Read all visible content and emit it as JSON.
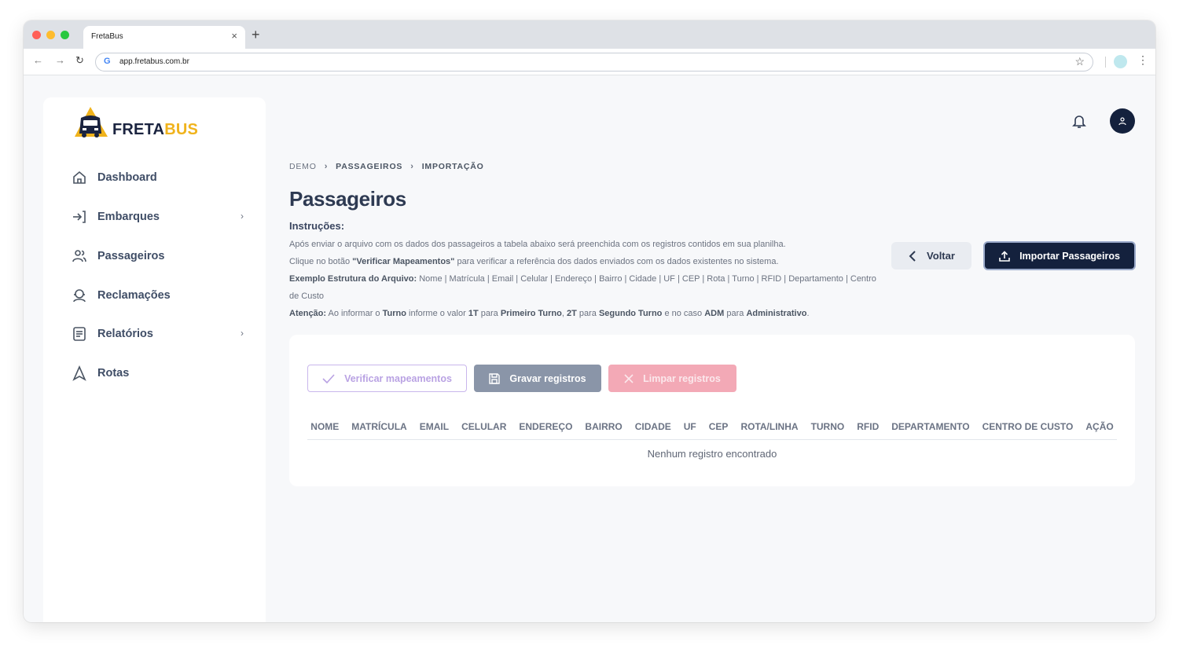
{
  "browser": {
    "tab_title": "FretaBus",
    "tab_close": "×",
    "new_tab": "+",
    "url": "app.fretabus.com.br",
    "traffic_lights": [
      "#ff5f57",
      "#febc2e",
      "#28c840"
    ]
  },
  "brand": {
    "name_part1": "FRETA",
    "name_part2": "BUS",
    "color_dark": "#1b2440",
    "color_accent": "#f0b31c"
  },
  "sidebar": {
    "items": [
      {
        "label": "Dashboard",
        "icon": "home-icon",
        "has_submenu": false
      },
      {
        "label": "Embarques",
        "icon": "login-arrow-icon",
        "has_submenu": true
      },
      {
        "label": "Passageiros",
        "icon": "users-icon",
        "has_submenu": false
      },
      {
        "label": "Reclamações",
        "icon": "support-agent-icon",
        "has_submenu": false
      },
      {
        "label": "Relatórios",
        "icon": "document-icon",
        "has_submenu": true
      },
      {
        "label": "Rotas",
        "icon": "navigation-icon",
        "has_submenu": false
      }
    ]
  },
  "breadcrumb": {
    "items": [
      "DEMO",
      "PASSAGEIROS",
      "IMPORTAÇÃO"
    ]
  },
  "page": {
    "title": "Passageiros",
    "instructions_title": "Instruções:",
    "line1": "Após enviar o arquivo com os dados dos passageiros a tabela abaixo será preenchida com os registros contidos em sua planilha.",
    "line2_a": "Clique no botão ",
    "line2_b": "\"Verificar Mapeamentos\"",
    "line2_c": " para verificar a referência dos dados enviados com os dados existentes no sistema.",
    "line3_a": "Exemplo Estrutura do Arquivo:",
    "line3_b": " Nome | Matrícula | Email | Celular | Endereço | Bairro | Cidade | UF | CEP | Rota | Turno | RFID | Departamento | Centro de Custo",
    "line4_a": "Atenção:",
    "line4_b": " Ao informar o ",
    "line4_c": "Turno",
    "line4_d": " informe o valor ",
    "line4_e": "1T",
    "line4_f": " para ",
    "line4_g": "Primeiro Turno",
    "line4_h": ", ",
    "line4_i": "2T",
    "line4_j": " para ",
    "line4_k": "Segundo Turno",
    "line4_l": " e no caso ",
    "line4_m": "ADM",
    "line4_n": " para ",
    "line4_o": "Administrativo",
    "line4_p": "."
  },
  "actions": {
    "back_label": "Voltar",
    "import_label": "Importar Passageiros"
  },
  "card": {
    "verify_label": "Verificar mapeamentos",
    "save_label": "Gravar registros",
    "clear_label": "Limpar registros",
    "columns": [
      "NOME",
      "MATRÍCULA",
      "EMAIL",
      "CELULAR",
      "ENDEREÇO",
      "BAIRRO",
      "CIDADE",
      "UF",
      "CEP",
      "ROTA/LINHA",
      "TURNO",
      "RFID",
      "DEPARTAMENTO",
      "CENTRO DE CUSTO",
      "AÇÃO"
    ],
    "empty_message": "Nenhum registro encontrado"
  }
}
